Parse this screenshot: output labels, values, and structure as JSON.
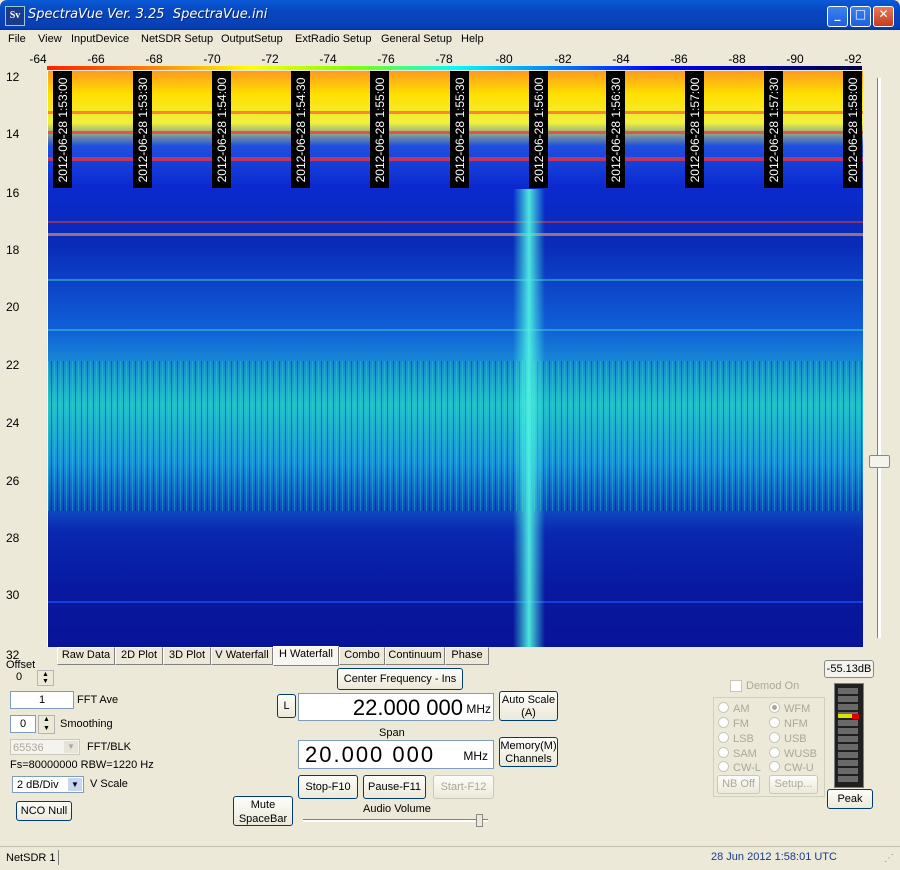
{
  "window": {
    "title": "SpectraVue Ver. 3.25  SpectraVue.ini",
    "icon_text": "Sv"
  },
  "menu": [
    "File",
    "View",
    "InputDevice",
    "NetSDR Setup",
    "OutputSetup",
    "ExtRadio Setup",
    "General Setup",
    "Help"
  ],
  "freq_axis": [
    "-64",
    "-66",
    "-68",
    "-70",
    "-72",
    "-74",
    "-76",
    "-78",
    "-80",
    "-82",
    "-84",
    "-86",
    "-88",
    "-90",
    "-92"
  ],
  "y_axis": [
    "12",
    "14",
    "16",
    "18",
    "20",
    "22",
    "24",
    "26",
    "28",
    "30",
    "32"
  ],
  "timestamps": [
    "2012-06-28 1:53:00",
    "2012-06-28 1:53:30",
    "2012-06-28 1:54:00",
    "2012-06-28 1:54:30",
    "2012-06-28 1:55:00",
    "2012-06-28 1:55:30",
    "2012-06-28 1:56:00",
    "2012-06-28 1:56:30",
    "2012-06-28 1:57:00",
    "2012-06-28 1:57:30",
    "2012-06-28 1:58:00"
  ],
  "tabs": [
    "Raw Data",
    "2D Plot",
    "3D Plot",
    "V Waterfall",
    "H Waterfall",
    "Combo",
    "Continuum",
    "Phase"
  ],
  "active_tab": "H Waterfall",
  "offset": {
    "label": "Offset",
    "value": "0"
  },
  "fft_ave": {
    "value": "1",
    "label": "FFT Ave"
  },
  "smoothing": {
    "value": "0",
    "label": "Smoothing"
  },
  "fft_blk": {
    "value": "65536",
    "label": "FFT/BLK"
  },
  "fs_info": "Fs=80000000 RBW=1220 Hz",
  "vscale": {
    "value": "2 dB/Div",
    "label": "V Scale"
  },
  "nco_null": "NCO Null",
  "mute": {
    "line1": "Mute",
    "line2": "SpaceBar"
  },
  "center_freq_button": "Center Frequency - Ins",
  "l_button": "L",
  "center_freq": {
    "value": "22.000 000",
    "unit": "MHz"
  },
  "span_label": "Span",
  "span": {
    "value": "20.000 000",
    "unit": "MHz"
  },
  "auto_scale": {
    "line1": "Auto Scale",
    "line2": "(A)"
  },
  "memory": {
    "line1": "Memory(M)",
    "line2": "Channels"
  },
  "stop_button": "Stop-F10",
  "pause_button": "Pause-F11",
  "start_button": "Start-F12",
  "audio_volume_label": "Audio Volume",
  "demod": {
    "label": "Demod On",
    "modes_left": [
      "AM",
      "FM",
      "LSB",
      "SAM",
      "CW-L"
    ],
    "modes_right": [
      "WFM",
      "NFM",
      "USB",
      "WUSB",
      "CW-U"
    ],
    "selected": "WFM",
    "nb_off": "NB Off",
    "setup": "Setup..."
  },
  "level_readout": "-55.13dB",
  "peak_button": "Peak",
  "status": {
    "device": "NetSDR 1",
    "datetime": "28 Jun 2012  1:58:01 UTC"
  },
  "colors": {
    "title_bar": "#0846c0",
    "waterfall_bg": "#0a1a9a",
    "signal": "#40e8e0"
  }
}
